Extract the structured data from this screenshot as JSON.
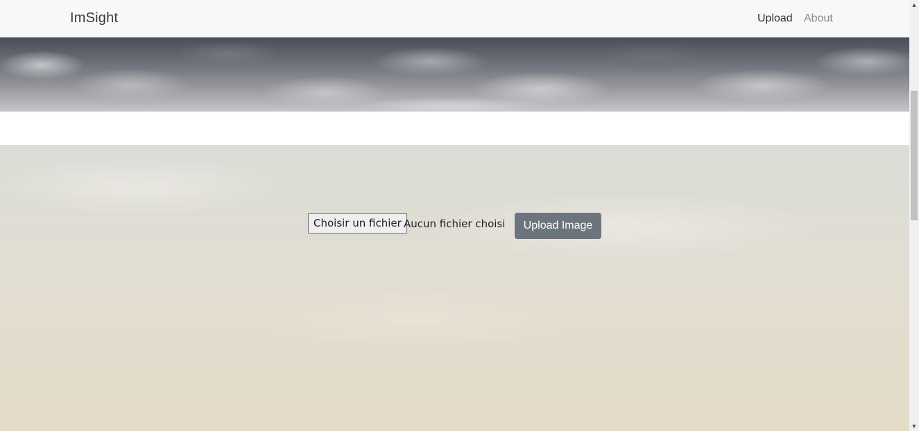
{
  "navbar": {
    "brand": "ImSight",
    "links": [
      {
        "label": "Upload",
        "active": true
      },
      {
        "label": "About",
        "active": false
      }
    ]
  },
  "upload_form": {
    "file_button_label": "Choisir un fichier",
    "file_status": "Aucun fichier choisi",
    "submit_label": "Upload Image"
  },
  "colors": {
    "navbar_bg": "#f7f8fa",
    "button_bg": "#6c757d",
    "button_text": "#ffffff"
  },
  "icons": {
    "scroll_up": "chevron-up-icon",
    "scroll_down": "chevron-down-icon"
  }
}
